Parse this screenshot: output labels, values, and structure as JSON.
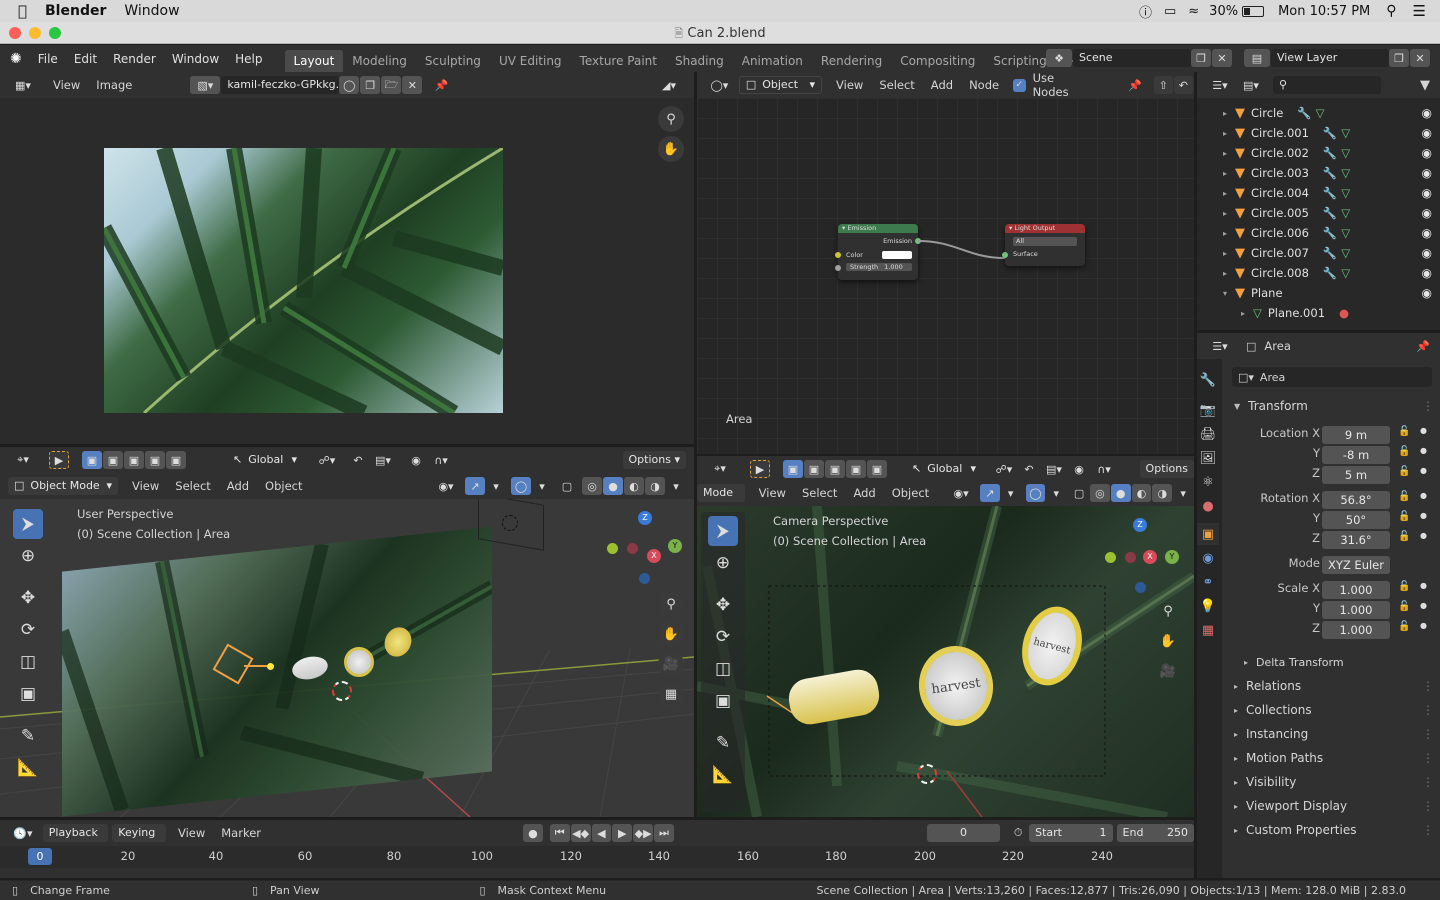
{
  "macos": {
    "apple": "",
    "app": "Blender",
    "menu": "Window",
    "battery": "30%",
    "clock": "Mon 10:57 PM"
  },
  "window": {
    "title": "Can 2.blend"
  },
  "menubar": {
    "items": [
      "File",
      "Edit",
      "Render",
      "Window",
      "Help"
    ],
    "workspaces": [
      "Layout",
      "Modeling",
      "Sculpting",
      "UV Editing",
      "Texture Paint",
      "Shading",
      "Animation",
      "Rendering",
      "Compositing",
      "Scripting"
    ],
    "active_workspace": "Layout",
    "add_tab": "+",
    "scene": "Scene",
    "view_layer": "View Layer"
  },
  "image_editor": {
    "menus": [
      "View",
      "Image"
    ],
    "image_name": "kamil-feczko-GPkkg..."
  },
  "node_editor": {
    "mode": "Object",
    "menus": [
      "View",
      "Select",
      "Add",
      "Node"
    ],
    "use_nodes_label": "Use Nodes",
    "use_nodes": true,
    "area_label": "Area",
    "emission_node": {
      "title": "Emission",
      "output": "Emission",
      "color_label": "Color",
      "strength_label": "Strength",
      "strength_value": "1.000"
    },
    "output_node": {
      "title": "Light Output",
      "target": "All",
      "input": "Surface"
    }
  },
  "viewport_left": {
    "transform": "Global",
    "options": "Options",
    "mode": "Object Mode",
    "menus": [
      "View",
      "Select",
      "Add",
      "Object"
    ],
    "perspective": "User Perspective",
    "collection": "(0) Scene Collection | Area"
  },
  "viewport_right": {
    "transform": "Global",
    "options": "Options",
    "mode": "Mode",
    "menus": [
      "View",
      "Select",
      "Add",
      "Object"
    ],
    "perspective": "Camera Perspective",
    "collection": "(0) Scene Collection | Area"
  },
  "gizmo": {
    "x": "X",
    "y": "Y",
    "z": "Z"
  },
  "outliner": {
    "items": [
      {
        "name": "Circle",
        "indent": 0
      },
      {
        "name": "Circle.001",
        "indent": 0
      },
      {
        "name": "Circle.002",
        "indent": 0
      },
      {
        "name": "Circle.003",
        "indent": 0
      },
      {
        "name": "Circle.004",
        "indent": 0
      },
      {
        "name": "Circle.005",
        "indent": 0
      },
      {
        "name": "Circle.006",
        "indent": 0
      },
      {
        "name": "Circle.007",
        "indent": 0
      },
      {
        "name": "Circle.008",
        "indent": 0
      },
      {
        "name": "Plane",
        "indent": 0
      },
      {
        "name": "Plane.001",
        "indent": 1
      }
    ]
  },
  "properties": {
    "object_name": "Area",
    "data_name": "Area",
    "transform_label": "Transform",
    "location": {
      "x_label": "Location X",
      "y_label": "Y",
      "z_label": "Z",
      "x": "9 m",
      "y": "-8 m",
      "z": "5 m"
    },
    "rotation": {
      "x_label": "Rotation X",
      "y_label": "Y",
      "z_label": "Z",
      "x": "56.8°",
      "y": "50°",
      "z": "31.6°"
    },
    "mode_label": "Mode",
    "mode_value": "XYZ Euler",
    "scale": {
      "x_label": "Scale X",
      "y_label": "Y",
      "z_label": "Z",
      "x": "1.000",
      "y": "1.000",
      "z": "1.000"
    },
    "delta": "Delta Transform",
    "panels": [
      "Relations",
      "Collections",
      "Instancing",
      "Motion Paths",
      "Visibility",
      "Viewport Display",
      "Custom Properties"
    ]
  },
  "timeline": {
    "menus": [
      "Playback",
      "Keying",
      "View",
      "Marker"
    ],
    "current_frame": "0",
    "start_label": "Start",
    "start": "1",
    "end_label": "End",
    "end": "250",
    "ruler": [
      "0",
      "20",
      "40",
      "60",
      "80",
      "100",
      "120",
      "140",
      "160",
      "180",
      "200",
      "220",
      "240"
    ]
  },
  "statusbar": {
    "left": "Change Frame",
    "mid": "Pan View",
    "right": "Mask Context Menu",
    "stats": "Scene Collection | Area | Verts:13,260 | Faces:12,877 | Tris:26,090 | Objects:1/13 | Mem: 128.0 MiB | 2.83.0"
  },
  "product_labels": {
    "brand": "harvest"
  },
  "colors": {
    "accent": "#4772b3",
    "object": "#f0a043",
    "mesh": "#6fc17e"
  }
}
